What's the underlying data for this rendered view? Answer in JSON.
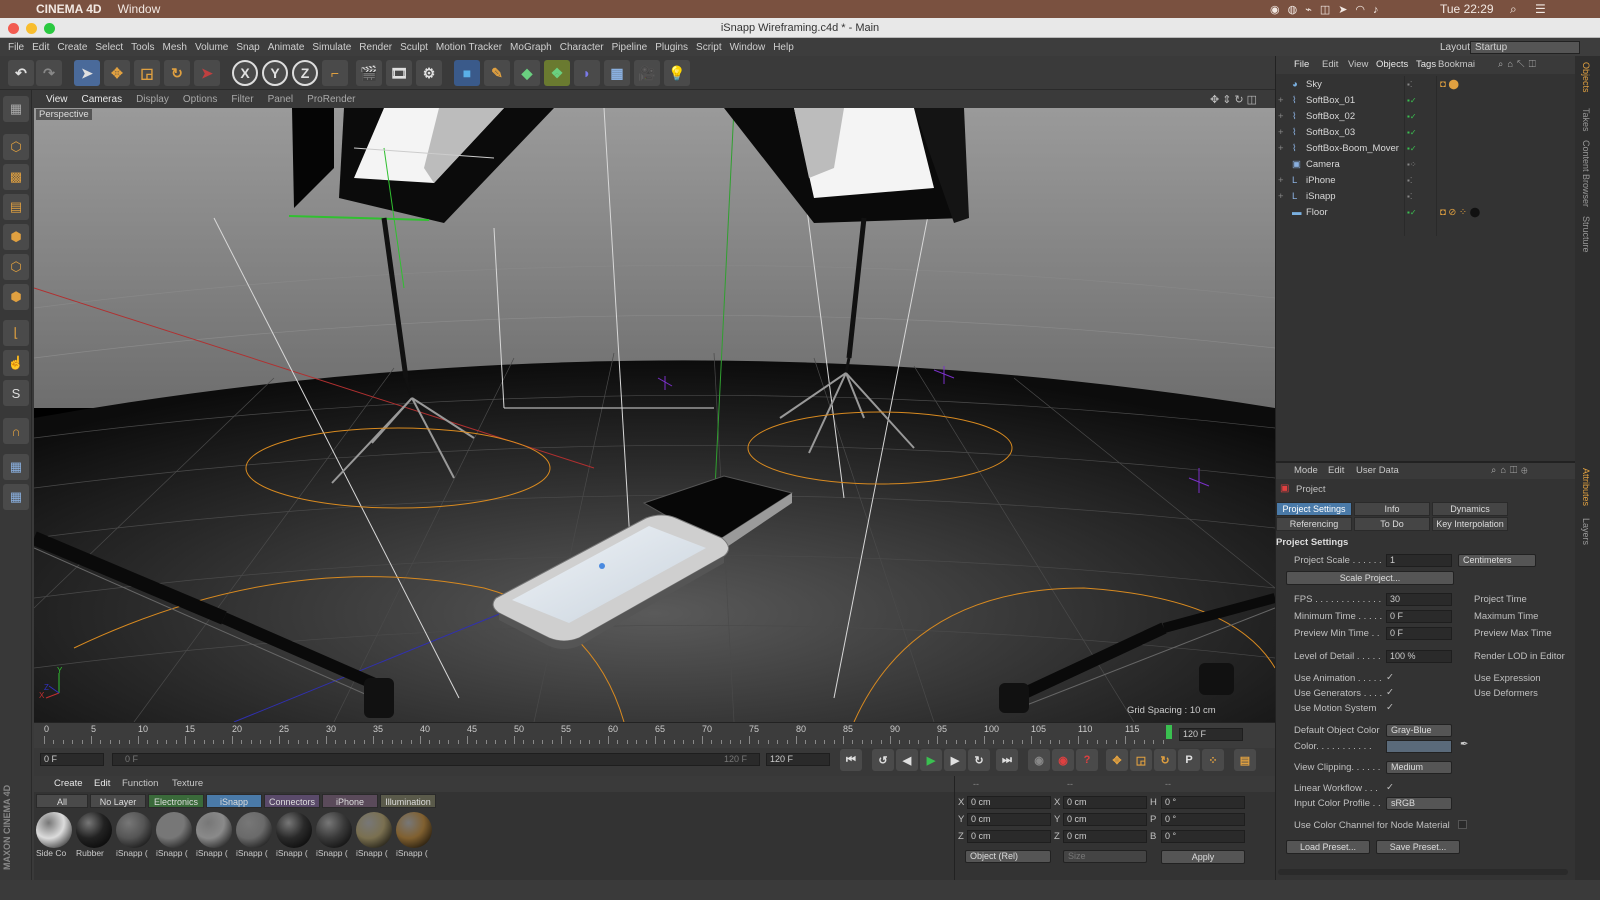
{
  "mac_menubar": {
    "app": "CINEMA 4D",
    "menu": "Window",
    "clock": "Tue 22:29"
  },
  "window": {
    "title": "iSnapp Wireframing.c4d * - Main"
  },
  "menu": [
    "File",
    "Edit",
    "Create",
    "Select",
    "Tools",
    "Mesh",
    "Volume",
    "Snap",
    "Animate",
    "Simulate",
    "Render",
    "Sculpt",
    "Motion Tracker",
    "MoGraph",
    "Character",
    "Pipeline",
    "Plugins",
    "Script",
    "Window",
    "Help"
  ],
  "layout": {
    "label": "Layout:",
    "value": "Startup"
  },
  "toolbar": {
    "x": "X",
    "y": "Y",
    "z": "Z"
  },
  "viewport_menu": [
    "View",
    "Cameras",
    "Display",
    "Options",
    "Filter",
    "Panel",
    "ProRender"
  ],
  "viewport": {
    "camera_label": "Perspective",
    "grid_spacing": "Grid Spacing : 10 cm",
    "axis_y": "Y",
    "axis_x": "X",
    "axis_z": "Z"
  },
  "timeline": {
    "ticks": [
      "0",
      "5",
      "10",
      "15",
      "20",
      "25",
      "30",
      "35",
      "40",
      "45",
      "50",
      "55",
      "60",
      "65",
      "70",
      "75",
      "80",
      "85",
      "90",
      "95",
      "100",
      "105",
      "110",
      "115"
    ],
    "end_frame": "120 F"
  },
  "transport": {
    "current": "0 F",
    "range_start": "0 F",
    "range_end": "120 F",
    "max": "120 F"
  },
  "materials": {
    "menu": [
      "Create",
      "Edit",
      "Function",
      "Texture"
    ],
    "layers": [
      "All",
      "No Layer",
      "Electronics",
      "iSnapp",
      "Connectors",
      "iPhone",
      "Illumination"
    ],
    "items": [
      {
        "label": "Side Co",
        "color": "#dcdcdc"
      },
      {
        "label": "Rubber",
        "color": "#222222"
      },
      {
        "label": "iSnapp (",
        "color": "#555555"
      },
      {
        "label": "iSnapp (",
        "color": "#777777"
      },
      {
        "label": "iSnapp (",
        "color": "#8a8a8a"
      },
      {
        "label": "iSnapp (",
        "color": "#6a6a6a"
      },
      {
        "label": "iSnapp (",
        "color": "#2a2a2a"
      },
      {
        "label": "iSnapp (",
        "color": "#3a3a3a"
      },
      {
        "label": "iSnapp (",
        "color": "#7a7050"
      },
      {
        "label": "iSnapp (",
        "color": "#806030"
      }
    ]
  },
  "coords": {
    "x": "0 cm",
    "y": "0 cm",
    "z": "0 cm",
    "size_x": "0 cm",
    "size_y": "0 cm",
    "size_z": "0 cm",
    "h": "0 °",
    "p": "0 °",
    "b": "0 °",
    "labels": {
      "x": "X",
      "y": "Y",
      "z": "Z",
      "h": "H",
      "p": "P",
      "b": "B"
    },
    "mode": "Object (Rel)",
    "size_mode": "Size",
    "apply": "Apply",
    "dashes": "--"
  },
  "objects": {
    "menu": [
      "File",
      "Edit",
      "View",
      "Objects",
      "Tags",
      "Bookmai"
    ],
    "items": [
      "Sky",
      "SoftBox_01",
      "SoftBox_02",
      "SoftBox_03",
      "SoftBox-Boom_Mover",
      "Camera",
      "iPhone",
      "iSnapp",
      "Floor"
    ]
  },
  "attributes": {
    "menu": [
      "Mode",
      "Edit",
      "User Data"
    ],
    "header": "Project",
    "tabs": [
      "Project Settings",
      "Info",
      "Dynamics",
      "Referencing",
      "To Do",
      "Key Interpolation"
    ],
    "section": "Project Settings",
    "project_scale_label": "Project Scale . . . . . .",
    "project_scale": "1",
    "unit": "Centimeters",
    "scale_button": "Scale Project...",
    "fps_label": "FPS . . . . . . . . . . . . .",
    "fps": "30",
    "project_time_label": "Project Time",
    "min_time_label": "Minimum Time . . . . .",
    "min_time": "0 F",
    "max_time_label": "Maximum Time",
    "prev_min_label": "Preview Min Time . .",
    "prev_min": "0 F",
    "prev_max_label": "Preview Max Time",
    "lod_label": "Level of Detail . . . . .",
    "lod": "100 %",
    "render_lod_label": "Render LOD in Editor",
    "use_animation": "Use Animation . . . . .",
    "use_expression": "Use Expression",
    "use_generators": "Use Generators . . . .",
    "use_deformers": "Use Deformers",
    "use_motion": "Use Motion System",
    "default_color_label": "Default Object Color",
    "default_color": "Gray-Blue",
    "color_label": "Color. . . . . . . . . . .",
    "view_clipping_label": "View Clipping. . . . . .",
    "view_clipping": "Medium",
    "linear_workflow": "Linear Workflow . . .",
    "input_profile_label": "Input Color Profile . .",
    "input_profile": "sRGB",
    "node_material": "Use Color Channel for Node Material",
    "load_preset": "Load Preset...",
    "save_preset": "Save Preset...",
    "check": "✓"
  },
  "right_tabs": [
    "Objects",
    "Takes",
    "Content Browser",
    "Structure",
    "Attributes",
    "Layers"
  ],
  "brand": "MAXON CINEMA 4D"
}
